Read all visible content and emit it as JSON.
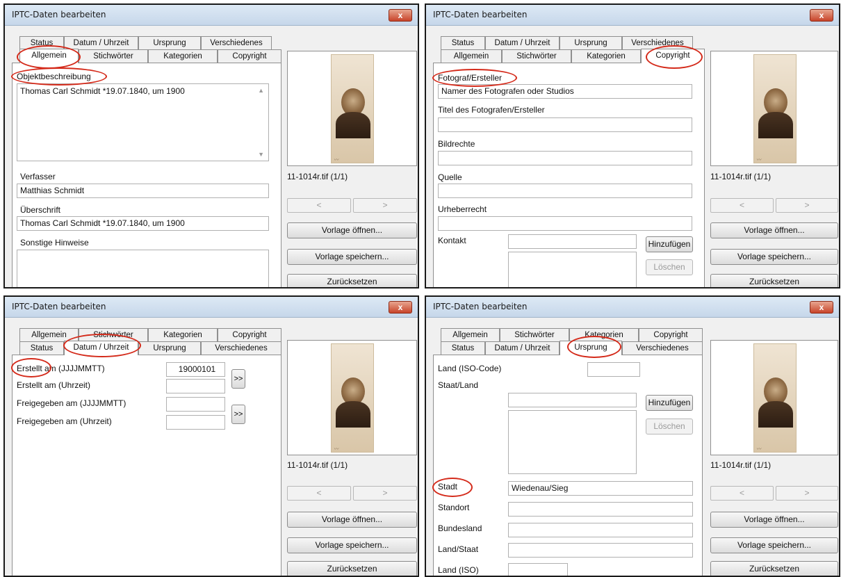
{
  "dialog": {
    "title": "IPTC-Daten bearbeiten",
    "close_label": "x",
    "filename": "11-1014r.tif (1/1)",
    "nav_prev": "<",
    "nav_next": ">",
    "open_template": "Vorlage öffnen...",
    "save_template": "Vorlage speichern...",
    "reset": "Zurücksetzen"
  },
  "tabs": {
    "status": "Status",
    "datum": "Datum / Uhrzeit",
    "ursprung": "Ursprung",
    "verschiedenes": "Verschiedenes",
    "allgemein": "Allgemein",
    "stichwoerter": "Stichwörter",
    "kategorien": "Kategorien",
    "copyright": "Copyright"
  },
  "allgemein": {
    "objekt_label": "Objektbeschreibung",
    "objekt_value": "Thomas Carl Schmidt *19.07.1840, um 1900",
    "verfasser_label": "Verfasser",
    "verfasser_value": "Matthias Schmidt",
    "ueberschrift_label": "Überschrift",
    "ueberschrift_value": "Thomas Carl Schmidt *19.07.1840, um 1900",
    "hinweise_label": "Sonstige Hinweise"
  },
  "copyright": {
    "fotograf_label": "Fotograf/Ersteller",
    "fotograf_value": "Namer des Fotografen oder Studios",
    "titel_label": "Titel des Fotografen/Ersteller",
    "bildrechte_label": "Bildrechte",
    "quelle_label": "Quelle",
    "urheber_label": "Urheberrecht",
    "kontakt_label": "Kontakt",
    "add_label": "Hinzufügen",
    "delete_label": "Löschen"
  },
  "datum": {
    "erstellt_label": "Erstellt am (JJJJMMTT)",
    "erstellt_value": "19000101",
    "erstellt_zeit_label": "Erstellt am (Uhrzeit)",
    "freigegeben_label": "Freigegeben am (JJJJMMTT)",
    "freigegeben_zeit_label": "Freigegeben am (Uhrzeit)",
    "arrow_label": ">>"
  },
  "ursprung": {
    "land_iso_code_label": "Land (ISO-Code)",
    "staat_land_label": "Staat/Land",
    "add_label": "Hinzufügen",
    "delete_label": "Löschen",
    "stadt_label": "Stadt",
    "stadt_value": "Wiedenau/Sieg",
    "standort_label": "Standort",
    "bundesland_label": "Bundesland",
    "land_staat_label": "Land/Staat",
    "land_iso_label": "Land (ISO)"
  },
  "colors": {
    "highlight_circle": "#d42a1a",
    "titlebar": "#c6d7ea",
    "close_button": "#c8442a"
  }
}
